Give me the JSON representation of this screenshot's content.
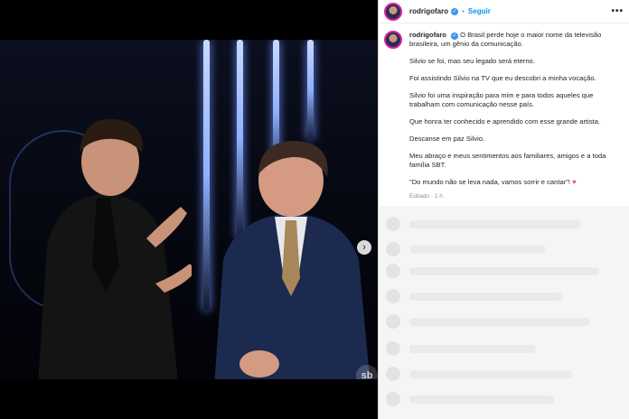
{
  "post": {
    "username": "rodrigofaro",
    "follow_label": "Seguir",
    "separator": "•",
    "more_label": "•••",
    "caption": {
      "username": "rodrigofaro",
      "lead": "O Brasil perde hoje o maior nome da televisão brasileira, um gênio da comunicação.",
      "paragraphs": [
        "Silvio se foi, mas seu legado será eterno.",
        "Foi assistindo Silvio na TV que eu descobri a minha vocação.",
        "Silvio foi uma inspiração para mim e para todos aqueles que trabalham com comunicação nesse país.",
        "Que honra ter conhecido e aprendido com esse grande artista.",
        "Descanse em paz Silvio.",
        "Meu abraço e meus sentimentos aos familiares, amigos e a toda família SBT.",
        "\"Do mundo não se leva nada, vamos sorrir e cantar\"!"
      ],
      "heart": "♥"
    },
    "meta": {
      "edited": "Editado",
      "separator": "·",
      "age": "1 h"
    }
  },
  "media": {
    "next_icon": "›",
    "watermark": "sb",
    "carousel_dots": 5,
    "active_dot": 3
  },
  "colors": {
    "accent": "#0095f6",
    "verified": "#3897f0",
    "heart": "#ed4956"
  },
  "icons": [
    "verified-icon",
    "more-icon",
    "chevron-right-icon",
    "heart-icon"
  ]
}
